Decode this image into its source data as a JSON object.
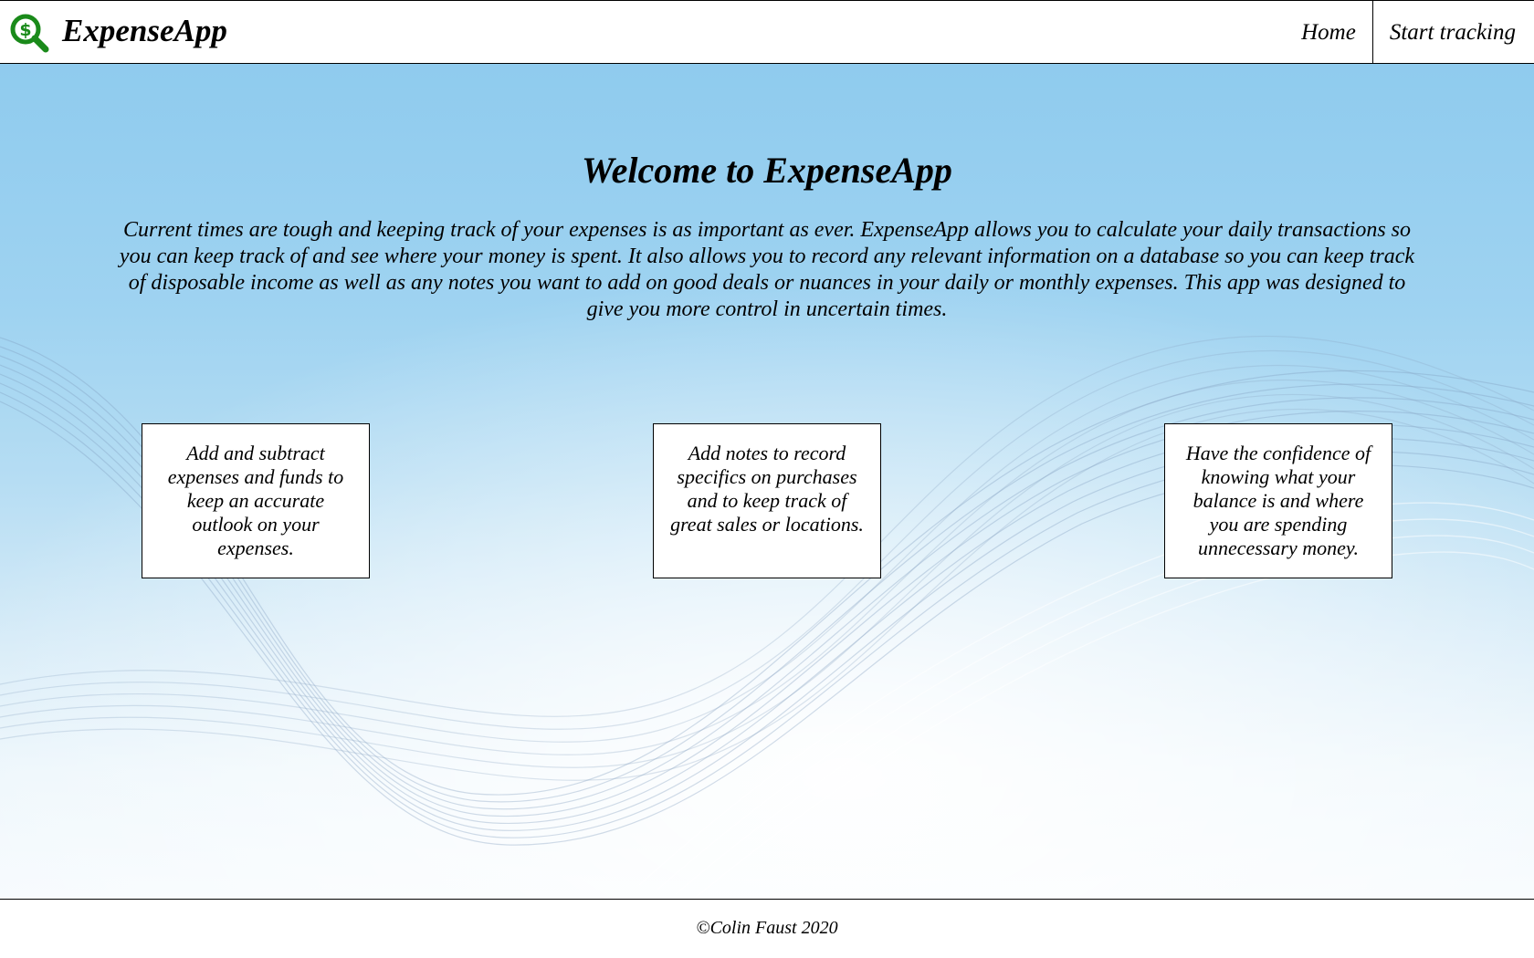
{
  "header": {
    "brand": "ExpenseApp",
    "logo_icon": "dollar-magnifier-icon",
    "nav": {
      "home_label": "Home",
      "start_label": "Start tracking"
    }
  },
  "hero": {
    "title": "Welcome to ExpenseApp",
    "description": "Current times are tough and keeping track of your expenses is as important as ever. ExpenseApp allows you to calculate your daily transactions so you can keep track of and see where your money is spent. It also allows you to record any relevant information on a database so you can keep track of disposable income as well as any notes you want to add on good deals or nuances in your daily or monthly expenses. This app was designed to give you more control in uncertain times.",
    "cards": [
      {
        "text": "Add and subtract expenses and funds to keep an accurate outlook on your expenses."
      },
      {
        "text": "Add notes to record specifics on purchases and to keep track of great sales or locations."
      },
      {
        "text": "Have the confidence of knowing what your balance is and where you are spending unnecessary money."
      }
    ]
  },
  "footer": {
    "copyright": "©Colin Faust 2020"
  },
  "colors": {
    "logo_green": "#1a8a1a",
    "sky_blue": "#8fcbee"
  }
}
